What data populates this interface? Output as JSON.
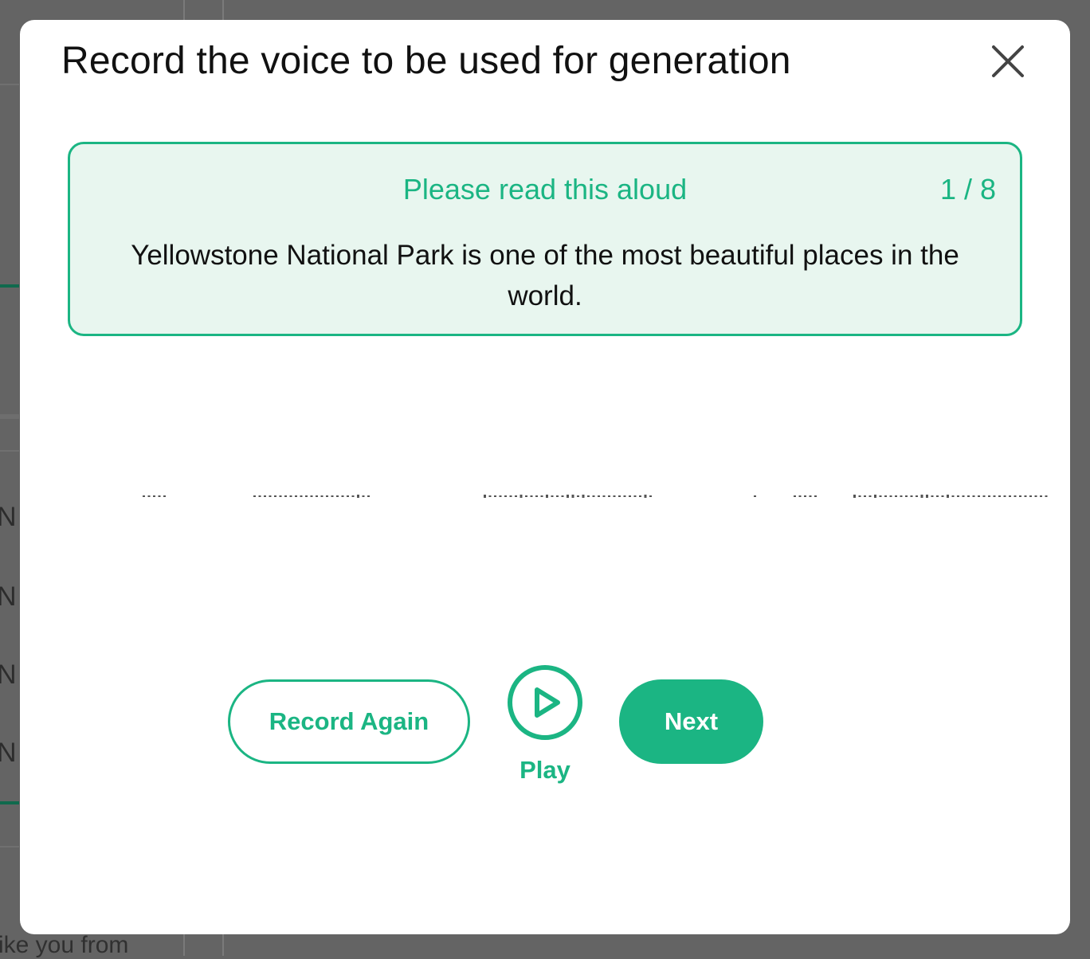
{
  "background": {
    "visible_text": "ike you from",
    "row_letters": [
      "N",
      "N",
      "N",
      "N"
    ]
  },
  "modal": {
    "title": "Record the voice to be used for generation",
    "close_icon": "close-icon"
  },
  "prompt": {
    "heading": "Please read this aloud",
    "counter": "1 / 8",
    "text": "Yellowstone National Park is one of the most beautiful places in the world."
  },
  "controls": {
    "record_again_label": "Record Again",
    "play_icon": "play-circle-icon",
    "play_label": "Play",
    "next_label": "Next"
  },
  "colors": {
    "accent": "#1bb583",
    "card_background": "#e8f6ef",
    "overlay": "#646464"
  }
}
